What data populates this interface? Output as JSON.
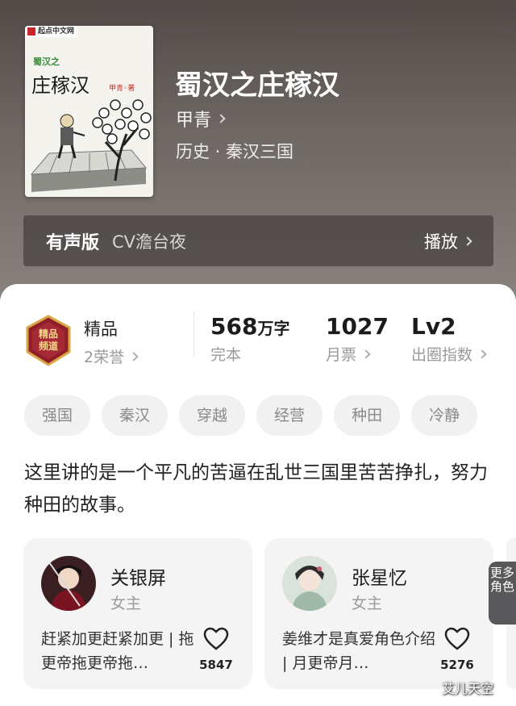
{
  "cover": {
    "badge": "起点中文网",
    "subtitle": "蜀汉之",
    "title": "庄稼汉",
    "author": "甲青◦著"
  },
  "book": {
    "title": "蜀汉之庄稼汉",
    "author": "甲青",
    "genre": "历史 · 秦汉三国"
  },
  "audio": {
    "label": "有声版",
    "cv": "CV澹台夜",
    "play": "播放"
  },
  "badge": {
    "title": "精品",
    "honors": "2荣誉",
    "medal_text": "精品频道"
  },
  "stats": [
    {
      "value": "568",
      "unit": "万字",
      "label": "完本"
    },
    {
      "value": "1027",
      "unit": "",
      "label": "月票"
    },
    {
      "value": "Lv2",
      "unit": "",
      "label": "出圈指数"
    }
  ],
  "tags": [
    "强国",
    "秦汉",
    "穿越",
    "经营",
    "种田",
    "冷静"
  ],
  "description": "这里讲的是一个平凡的苦逼在乱世三国里苦苦挣扎，努力种田的故事。",
  "characters": [
    {
      "name": "关银屏",
      "role": "女主",
      "quote": "赶紧加更赶紧加更 | 拖更帝拖更帝拖…",
      "likes": "5847"
    },
    {
      "name": "张星忆",
      "role": "女主",
      "quote": "姜维才是真爱角色介绍 | 月更帝月…",
      "likes": "5276"
    }
  ],
  "more_roles": "更多角色",
  "watermark": "艾儿天空",
  "colors": {
    "accent_medal": "#8e1f2a",
    "text_primary": "#222222",
    "text_secondary": "#9a9a9a"
  }
}
